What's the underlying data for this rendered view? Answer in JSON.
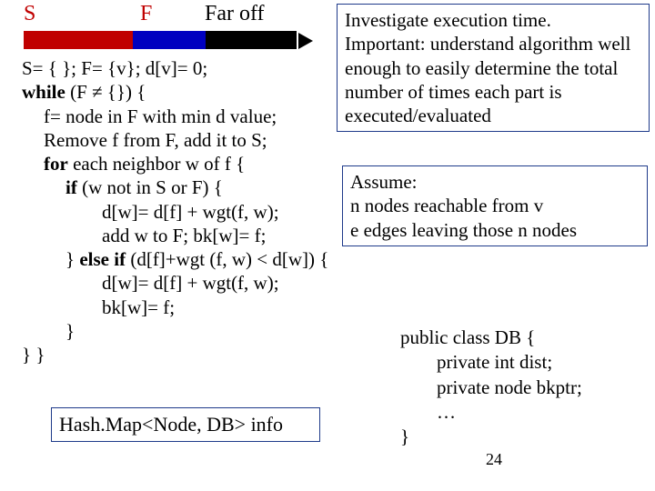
{
  "labels": {
    "s": "S",
    "f": "F",
    "far": "Far off"
  },
  "code": {
    "l1a": "S=  { };  F=  {v};  d[v]= 0;",
    "l2a": "while",
    "l2b": "  (F ≠  {}) {",
    "l3": "f= node in F with min d value;",
    "l4": "Remove f from F, add it to S;",
    "l5a": "for",
    "l5b": " each neighbor w of f {",
    "l6a": "if",
    "l6b": " (w not in S or F) {",
    "l7": "d[w]=  d[f] + wgt(f, w);",
    "l8": "add w to F;  bk[w]=  f;",
    "l9a": "} ",
    "l9b": "else if",
    "l9c": " (d[f]+wgt (f, w) < d[w]) {",
    "l10": "d[w]= d[f] + wgt(f, w);",
    "l11": "bk[w]=  f;",
    "l12": "}",
    "l13": "} }"
  },
  "box1": {
    "a": "Investigate execution time.",
    "b": "Important: understand algorithm well enough to easily determine the total number of times each part is executed/evaluated"
  },
  "box2": {
    "a": "Assume:",
    "b": "n nodes reachable from v",
    "c": "e edges leaving those n nodes"
  },
  "box3": "Hash.Map<Node, DB> info",
  "cls": {
    "a": "public class DB {",
    "b": "private int dist;",
    "c": "private node bkptr;",
    "d": "…",
    "e": "}"
  },
  "slide": "24"
}
